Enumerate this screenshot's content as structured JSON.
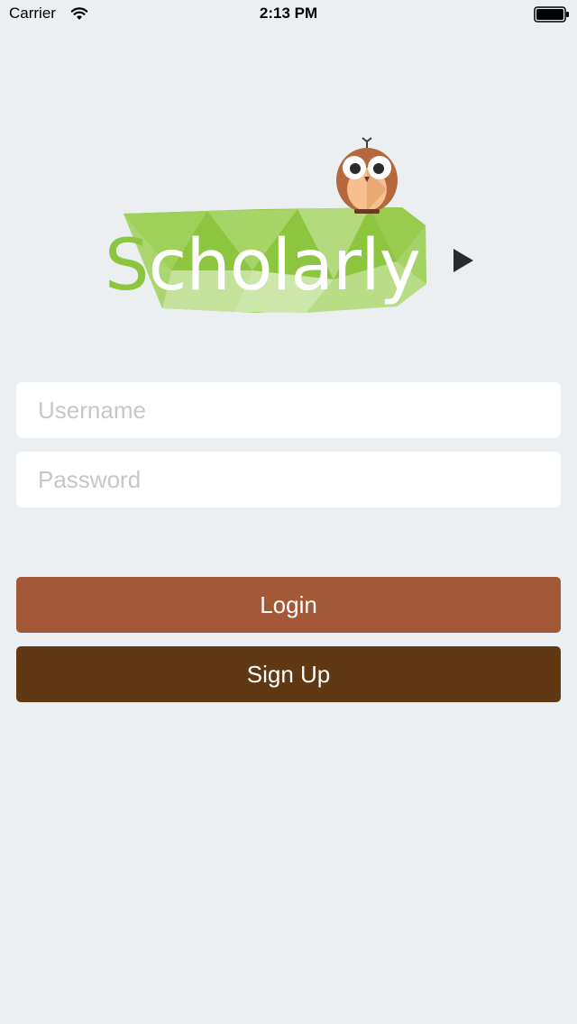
{
  "status_bar": {
    "carrier": "Carrier",
    "time": "2:13 PM"
  },
  "logo": {
    "text_first_letter": "S",
    "text_rest": "cholarly"
  },
  "form": {
    "username_placeholder": "Username",
    "password_placeholder": "Password"
  },
  "buttons": {
    "login_label": "Login",
    "signup_label": "Sign Up"
  },
  "colors": {
    "background": "#ebeff1",
    "login_button": "#a35937",
    "signup_button": "#603914",
    "logo_green": "#8cc63f"
  }
}
